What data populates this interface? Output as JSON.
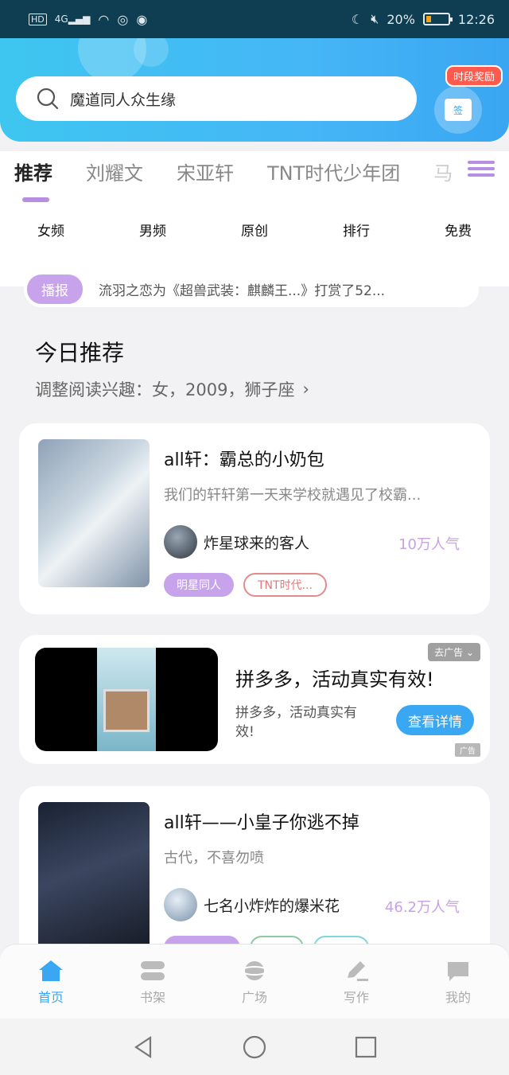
{
  "status_bar": {
    "hd": "HD",
    "signal": "4G",
    "battery": "20%",
    "time": "12:26"
  },
  "header": {
    "search_placeholder": "魔道同人众生缘",
    "gift_tag": "时段奖励",
    "gift_label": "签"
  },
  "tabs": [
    "推荐",
    "刘耀文",
    "宋亚轩",
    "TNT时代少年团",
    "马"
  ],
  "categories": [
    "女频",
    "男频",
    "原创",
    "排行",
    "免费"
  ],
  "broadcast": {
    "badge": "播报",
    "text": "流羽之恋为《超兽武装：麒麟王...》打赏了52..."
  },
  "section": {
    "title": "今日推荐",
    "subtitle": "调整阅读兴趣：女，2009，狮子座"
  },
  "books": [
    {
      "title": "all轩：霸总的小奶包",
      "desc": "我们的轩轩第一天来学校就遇见了校霸...",
      "author": "炸星球来的客人",
      "popularity": "10万人气",
      "tags": [
        "明星同人",
        "TNT时代..."
      ]
    },
    {
      "title": "all轩——小皇子你逃不掉",
      "desc": "古代，不喜勿喷",
      "author": "七名小炸炸的爆米花",
      "popularity": "46.2万人气"
    }
  ],
  "ad": {
    "title": "拼多多，活动真实有效!",
    "desc": "拼多多，活动真实有效!",
    "button": "查看详情",
    "close": "去广告",
    "mark": "广告"
  },
  "bottom_nav": [
    "首页",
    "书架",
    "广场",
    "写作",
    "我的"
  ],
  "colors": {
    "accent_blue": "#3aa7f2",
    "accent_purple": "#c7a3ec"
  }
}
